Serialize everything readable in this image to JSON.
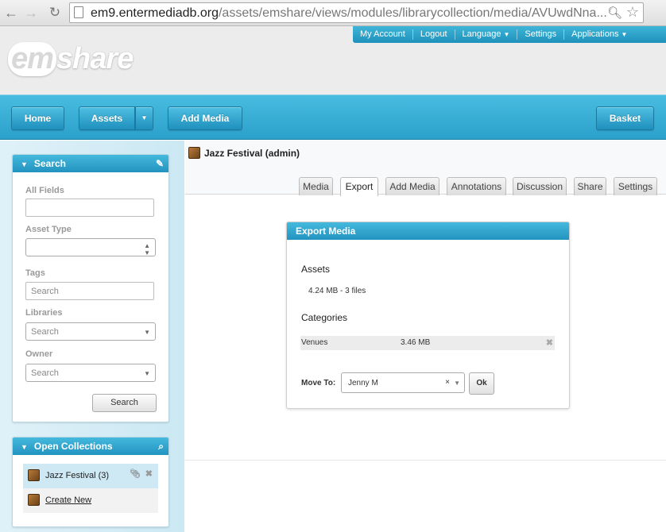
{
  "browser": {
    "url_host": "em9.entermediadb.org",
    "url_path": "/assets/emshare/views/modules/librarycollection/media/AVUwdNna..."
  },
  "header": {
    "logo": "emshare",
    "logo_em": "em",
    "logo_rest": "share",
    "menu": [
      "My Account",
      "Logout",
      "Language",
      "Settings",
      "Applications"
    ]
  },
  "nav": {
    "home": "Home",
    "assets": "Assets",
    "add_media": "Add Media",
    "basket": "Basket"
  },
  "search_panel": {
    "title": "Search",
    "all_fields_label": "All Fields",
    "all_fields_value": "",
    "asset_type_label": "Asset Type",
    "asset_type_value": "",
    "tags_label": "Tags",
    "tags_placeholder": "Search",
    "libraries_label": "Libraries",
    "libraries_placeholder": "Search",
    "owner_label": "Owner",
    "owner_placeholder": "Search",
    "search_button": "Search"
  },
  "collections_panel": {
    "title": "Open Collections",
    "items": [
      {
        "label": "Jazz Festival (3)"
      },
      {
        "label": "Create New"
      }
    ]
  },
  "content": {
    "title": "Jazz Festival (admin)",
    "tabs": [
      "Media",
      "Export",
      "Add Media",
      "Annotations",
      "Discussion",
      "Share",
      "Settings"
    ],
    "active_tab": "Export"
  },
  "export": {
    "title": "Export Media",
    "assets_heading": "Assets",
    "assets_summary": "4.24 MB - 3 files",
    "categories_heading": "Categories",
    "categories": [
      {
        "name": "Venues",
        "size": "3.46 MB"
      }
    ],
    "move_to_label": "Move To:",
    "move_to_value": "Jenny M",
    "ok_button": "Ok"
  }
}
